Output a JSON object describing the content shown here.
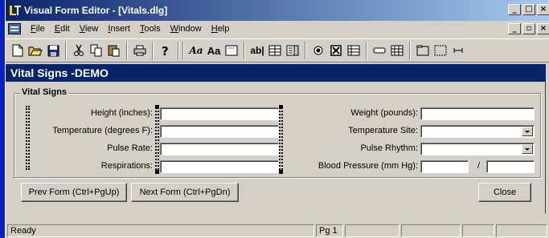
{
  "window": {
    "title": "Visual Form Editor - [Vitals.dlg]",
    "caption_buttons": [
      "_",
      "□",
      "×"
    ],
    "mdi_buttons": [
      "_",
      "🗗",
      "×"
    ]
  },
  "menu": [
    "File",
    "Edit",
    "View",
    "Insert",
    "Tools",
    "Window",
    "Help"
  ],
  "toolbar": {
    "font_italic": "Aa",
    "font_normal": "Aa",
    "label_tool": "ab|"
  },
  "form": {
    "title": "Vital Signs -DEMO",
    "group_title": "Vital Signs",
    "left_labels": {
      "height": "Height (inches):",
      "temperature": "Temperature (degrees F):",
      "pulse_rate": "Pulse Rate:",
      "respirations": "Respirations:"
    },
    "right_labels": {
      "weight": "Weight (pounds):",
      "temp_site": "Temperature Site:",
      "pulse_rhythm": "Pulse Rhythm:",
      "blood_pressure": "Blood Pressure (mm Hg):"
    },
    "bp_separator": "/",
    "buttons": {
      "prev": "Prev Form (Ctrl+PgUp)",
      "next": "Next Form (Ctrl+PgDn)",
      "close": "Close"
    }
  },
  "status": {
    "text": "Ready",
    "page": "Pg 1"
  },
  "colors": {
    "desktop": "#0a1fc8",
    "title_bar": "#0a246a",
    "face": "#d4d0c8"
  }
}
